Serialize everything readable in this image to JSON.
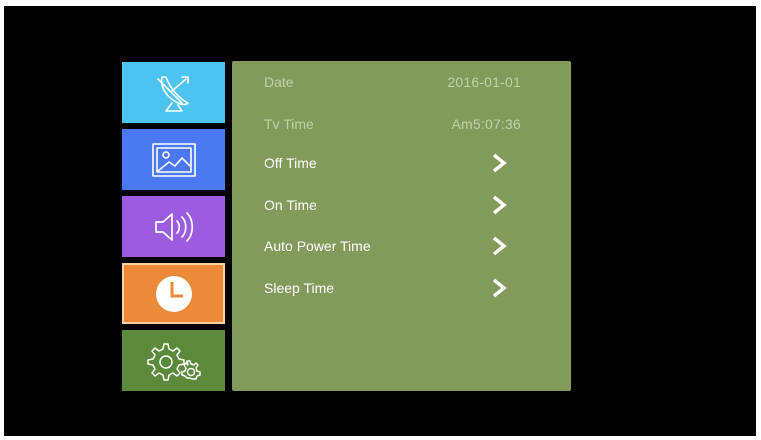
{
  "colors": {
    "screen_bg": "#000000",
    "panel_bg": "#829b5b",
    "tab_channel": "#4dc3f0",
    "tab_picture": "#4a78f0",
    "tab_sound": "#9b5ce0",
    "tab_time": "#ec8a3a",
    "tab_setup": "#5a8a3a"
  },
  "sidebar": {
    "tabs": [
      {
        "id": "channel",
        "icon": "satellite-dish-icon"
      },
      {
        "id": "picture",
        "icon": "picture-icon"
      },
      {
        "id": "sound",
        "icon": "speaker-icon"
      },
      {
        "id": "time",
        "icon": "clock-icon",
        "selected": true
      },
      {
        "id": "setup",
        "icon": "gears-icon"
      }
    ]
  },
  "time_menu": {
    "date": {
      "label": "Date",
      "value": "2016-01-01"
    },
    "tv_time": {
      "label": "Tv Time",
      "value": "Am5:07:36"
    },
    "items": [
      {
        "label": "Off Time",
        "icon": "chevron-right-icon"
      },
      {
        "label": "On Time",
        "icon": "chevron-right-icon"
      },
      {
        "label": "Auto Power Time",
        "icon": "chevron-right-icon"
      },
      {
        "label": "Sleep Time",
        "icon": "chevron-right-icon"
      }
    ]
  }
}
